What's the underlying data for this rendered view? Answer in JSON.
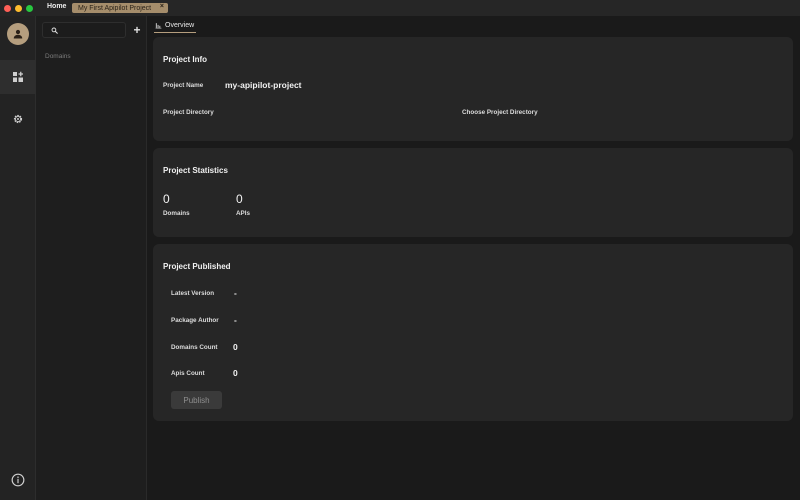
{
  "titlebar": {
    "home_tab": "Home",
    "project_tab": "My First Apipilot Project",
    "close_glyph": "×"
  },
  "rail": {
    "items": [
      {
        "icon": "avatar-icon"
      },
      {
        "icon": "dashboard-add-icon",
        "active": true
      },
      {
        "icon": "gear-icon"
      },
      {
        "icon": "info-icon"
      }
    ]
  },
  "sidebar": {
    "search_placeholder": "",
    "add_glyph": "+",
    "section_label": "Domains"
  },
  "main": {
    "tab_label": "Overview",
    "project_info": {
      "title": "Project Info",
      "name_label": "Project Name",
      "name_value": "my-apipilot-project",
      "dir_label": "Project Directory",
      "choose_dir": "Choose Project Directory"
    },
    "stats": {
      "title": "Project Statistics",
      "domains_count": "0",
      "domains_label": "Domains",
      "apis_count": "0",
      "apis_label": "APIs"
    },
    "published": {
      "title": "Project Published",
      "rows": [
        {
          "label": "Latest Version",
          "value": "-"
        },
        {
          "label": "Package Author",
          "value": "-"
        },
        {
          "label": "Domains Count",
          "value": "0"
        },
        {
          "label": "Apis Count",
          "value": "0"
        }
      ],
      "publish_label": "Publish"
    }
  },
  "colors": {
    "accent": "#b59e7e",
    "tab_active_bg": "#a58d6b",
    "card_bg": "#262626",
    "background": "#1a1a1a"
  }
}
